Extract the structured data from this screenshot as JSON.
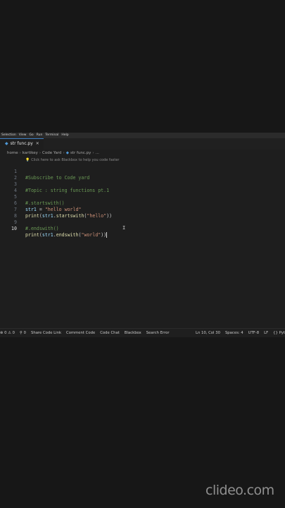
{
  "menu": [
    "Selection",
    "View",
    "Go",
    "Run",
    "Terminal",
    "Help"
  ],
  "tab": {
    "label": "str func.py",
    "close": "✕"
  },
  "breadcrumb": [
    "home",
    "kartikey",
    "Code Yard",
    "str func.py",
    "..."
  ],
  "hint": "Click here to ask Blackbox to help you code faster",
  "lines": [
    {
      "n": "1",
      "text": "#Subscribe to Code yard"
    },
    {
      "n": "2",
      "text": ""
    },
    {
      "n": "3",
      "text": "#Topic : string functions pt.1"
    },
    {
      "n": "4",
      "text": ""
    },
    {
      "n": "5",
      "text": "#.startswith()"
    },
    {
      "n": "6",
      "text": "str1 = \"hello world\""
    },
    {
      "n": "7",
      "text": "print(str1.startswith(\"hello\"))"
    },
    {
      "n": "8",
      "text": ""
    },
    {
      "n": "9",
      "text": "#.endswith()"
    },
    {
      "n": "10",
      "text": "print(str1.endswith(\"world\"))"
    }
  ],
  "status": {
    "errors": "0",
    "warnings": "0",
    "ports": "0",
    "left": [
      "Share Code Link",
      "Comment Code",
      "Code Chat",
      "Blackbox",
      "Search Error"
    ],
    "right": [
      "Ln 10, Col 30",
      "Spaces: 4",
      "UTF-8",
      "LF",
      "{} Pyt"
    ]
  },
  "watermark": "clideo.com"
}
